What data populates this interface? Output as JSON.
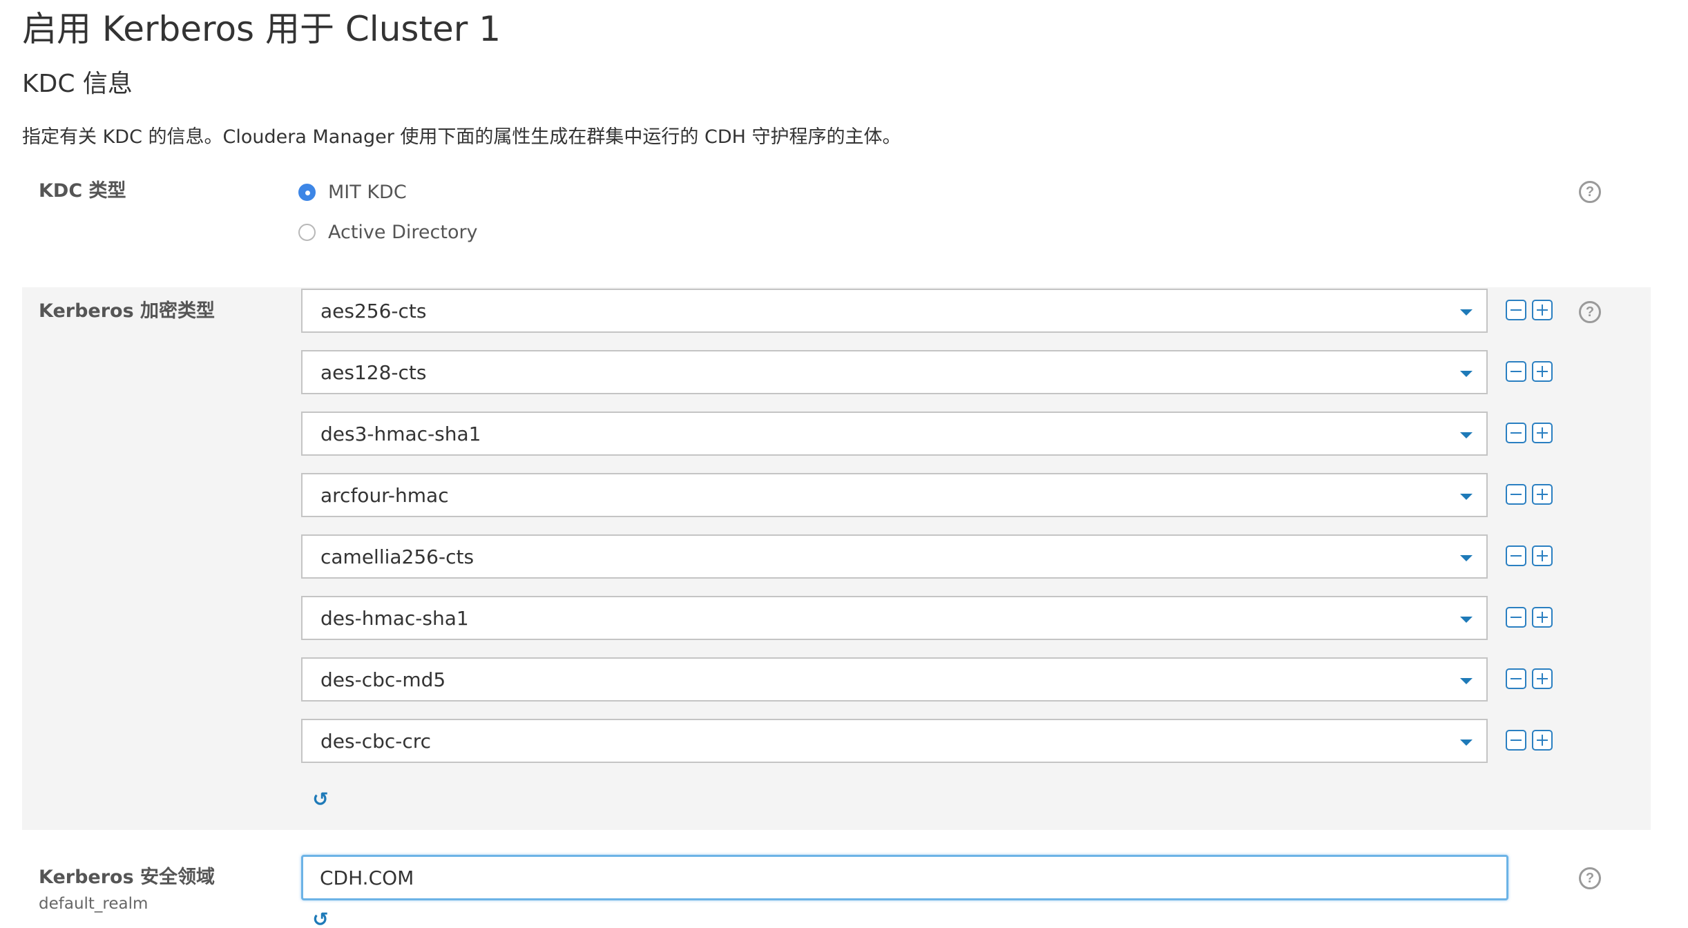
{
  "page": {
    "title": "启用 Kerberos 用于 Cluster 1"
  },
  "section": {
    "title": "KDC 信息",
    "description": "指定有关 KDC 的信息。Cloudera Manager 使用下面的属性生成在群集中运行的 CDH 守护程序的主体。"
  },
  "kdc_type": {
    "label": "KDC 类型",
    "options": [
      {
        "label": "MIT KDC",
        "selected": true
      },
      {
        "label": "Active Directory",
        "selected": false
      }
    ]
  },
  "encryption": {
    "label": "Kerberos 加密类型",
    "values": [
      "aes256-cts",
      "aes128-cts",
      "des3-hmac-sha1",
      "arcfour-hmac",
      "camellia256-cts",
      "des-hmac-sha1",
      "des-cbc-md5",
      "des-cbc-crc"
    ]
  },
  "realm": {
    "label": "Kerberos 安全领域",
    "sublabel": "default_realm",
    "value": "CDH.COM"
  },
  "icons": {
    "help": "question-circle-icon",
    "remove": "minus-square-icon",
    "add": "plus-square-icon",
    "reset": "undo-icon"
  },
  "colors": {
    "accent": "#2a7fc1",
    "radio_selected": "#3d86e6",
    "panel_bg": "#f4f4f4",
    "focus_border": "#6cb3e6"
  }
}
